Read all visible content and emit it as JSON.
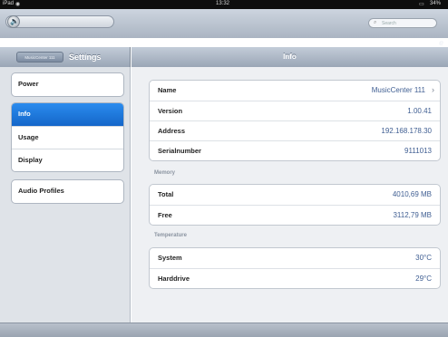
{
  "status_bar": {
    "carrier": "iPad",
    "wifi_icon": "wifi-icon",
    "time": "13:32",
    "battery": "34%"
  },
  "toolbar": {
    "volume_icon": "speaker-icon",
    "search_placeholder": "Search"
  },
  "left_header": {
    "back_label": "MusicCenter 111",
    "title": "Settings"
  },
  "right_header": {
    "title": "Info"
  },
  "menu": {
    "group1": [
      {
        "label": "Power",
        "selected": false
      }
    ],
    "group2": [
      {
        "label": "Info",
        "selected": true
      },
      {
        "label": "Usage",
        "selected": false
      },
      {
        "label": "Display",
        "selected": false
      }
    ],
    "group3": [
      {
        "label": "Audio Profiles",
        "selected": false
      }
    ]
  },
  "info": {
    "rows": [
      {
        "label": "Name",
        "value": "MusicCenter 111"
      },
      {
        "label": "Version",
        "value": "1.00.41"
      },
      {
        "label": "Address",
        "value": "192.168.178.30"
      },
      {
        "label": "Serialnumber",
        "value": "9111013"
      }
    ]
  },
  "memory": {
    "section_label": "Memory",
    "rows": [
      {
        "label": "Total",
        "value": "4010,69 MB"
      },
      {
        "label": "Free",
        "value": "3112,79 MB"
      }
    ]
  },
  "temperature": {
    "section_label": "Temperature",
    "rows": [
      {
        "label": "System",
        "value": "30°C"
      },
      {
        "label": "Harddrive",
        "value": "29°C"
      }
    ]
  },
  "colors": {
    "selection": "#1b74dc",
    "value_text": "#3f5e92",
    "toolbar": "#b7c0cc"
  }
}
